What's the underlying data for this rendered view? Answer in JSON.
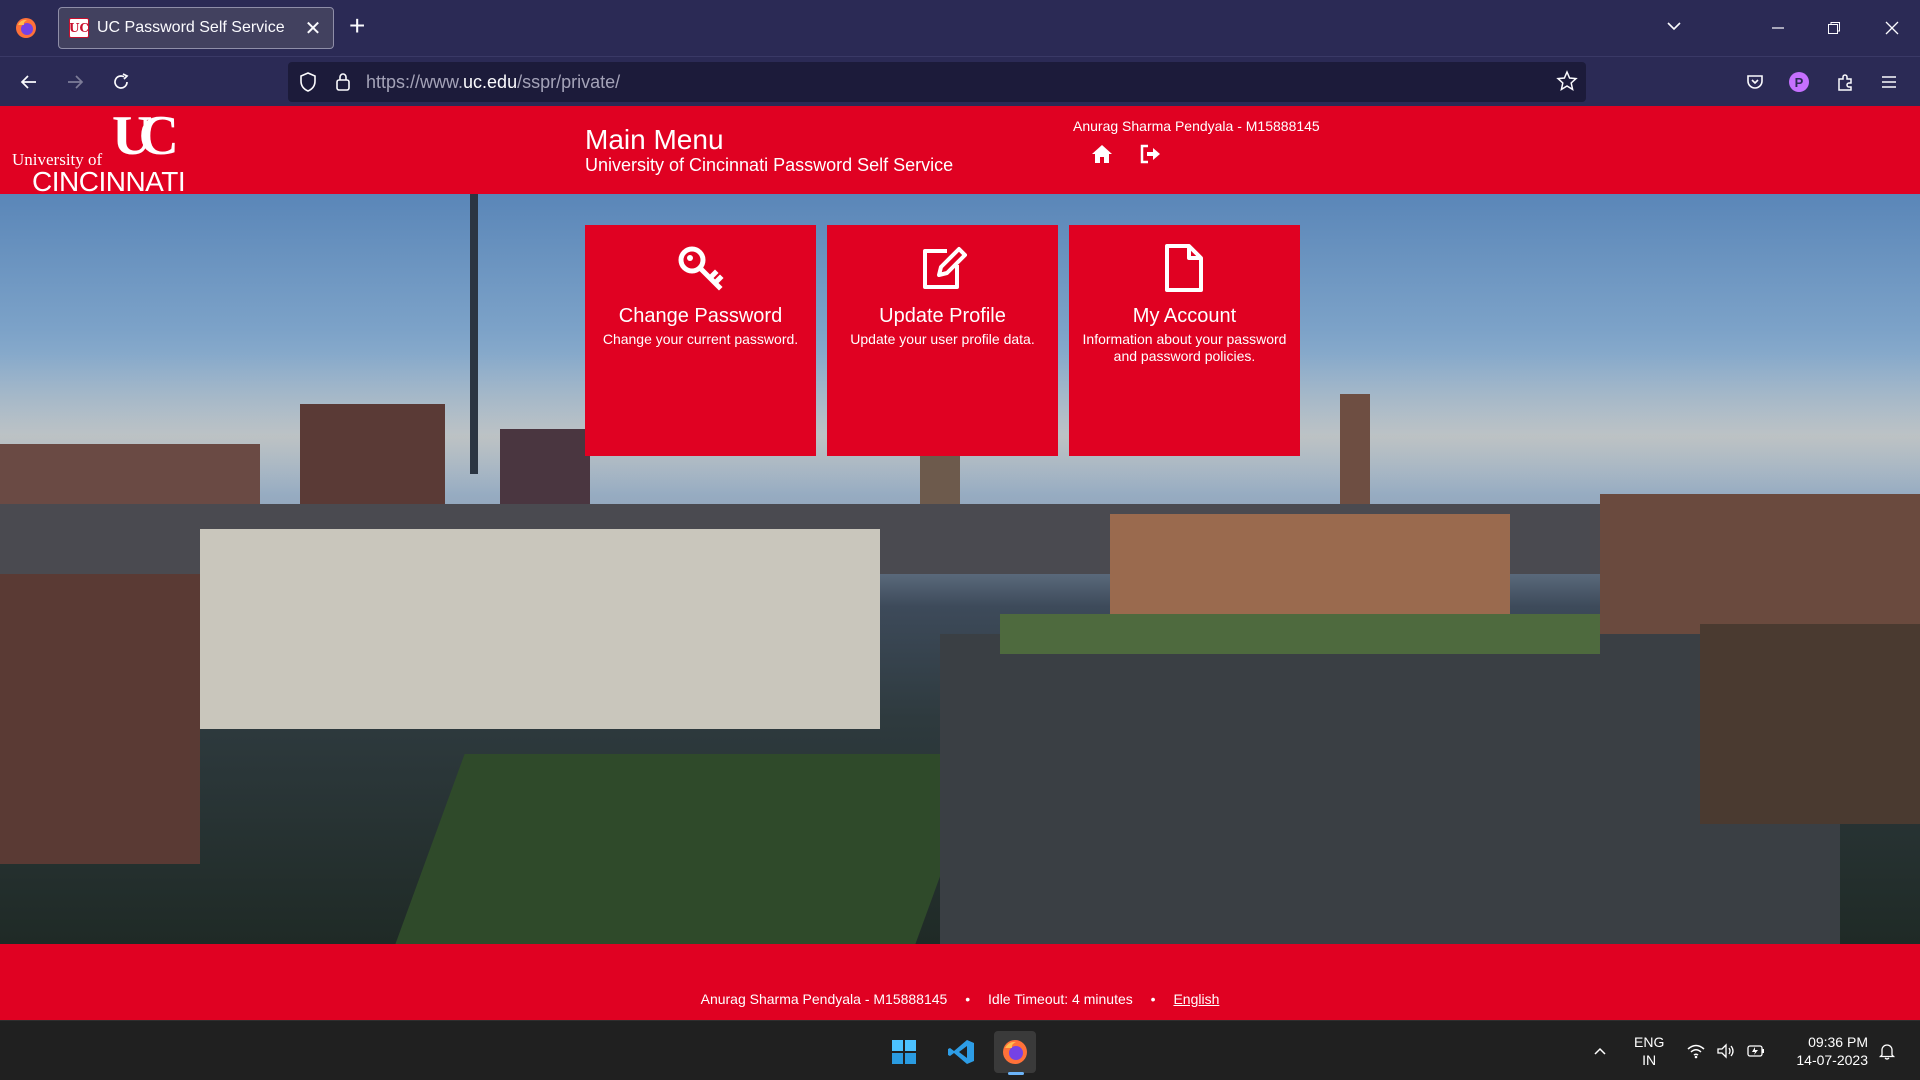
{
  "browser": {
    "tab_title": "UC Password Self Service",
    "tab_favicon_text": "UC",
    "url_prefix": "https://www.",
    "url_host": "uc.edu",
    "url_path": "/sspr/private/",
    "profile_initial": "P"
  },
  "header": {
    "logo_top": "UC",
    "logo_university": "University of",
    "logo_name": "CINCINNATI",
    "title": "Main Menu",
    "subtitle": "University of Cincinnati Password Self Service",
    "user": "Anurag Sharma Pendyala - M15888145",
    "icons": [
      "home-icon",
      "logout-icon"
    ]
  },
  "tiles": [
    {
      "title": "Change Password",
      "description": "Change your current password.",
      "icon": "key-icon"
    },
    {
      "title": "Update Profile",
      "description": "Update your user profile data.",
      "icon": "edit-icon"
    },
    {
      "title": "My Account",
      "description": "Information about your password and password policies.",
      "icon": "document-icon"
    }
  ],
  "footer": {
    "user": "Anurag Sharma Pendyala - M15888145",
    "idle_timeout": "Idle Timeout: 4 minutes",
    "separator": "•",
    "language": "English"
  },
  "taskbar": {
    "lang_top": "ENG",
    "lang_bottom": "IN",
    "time": "09:36 PM",
    "date": "14-07-2023"
  },
  "colors": {
    "uc_red": "#e00122",
    "browser_chrome": "#2b2a55",
    "taskbar": "#202020"
  }
}
